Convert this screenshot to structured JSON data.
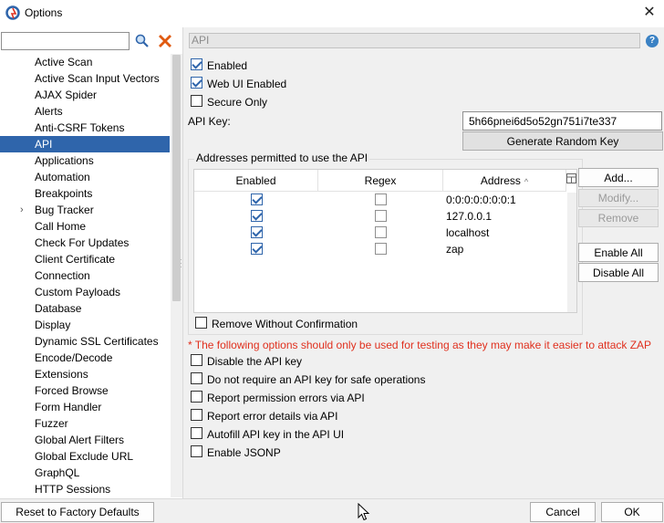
{
  "window": {
    "title": "Options",
    "close_glyph": "✕"
  },
  "sidebar": {
    "search_value": "",
    "items": [
      "Active Scan",
      "Active Scan Input Vectors",
      "AJAX Spider",
      "Alerts",
      "Anti-CSRF Tokens",
      "API",
      "Applications",
      "Automation",
      "Breakpoints",
      "Bug Tracker",
      "Call Home",
      "Check For Updates",
      "Client Certificate",
      "Connection",
      "Custom Payloads",
      "Database",
      "Display",
      "Dynamic SSL Certificates",
      "Encode/Decode",
      "Extensions",
      "Forced Browse",
      "Form Handler",
      "Fuzzer",
      "Global Alert Filters",
      "Global Exclude URL",
      "GraphQL",
      "HTTP Sessions"
    ],
    "selected": "API",
    "expandable": "Bug Tracker"
  },
  "panel": {
    "title": "API",
    "help_glyph": "?",
    "enabled_label": "Enabled",
    "enabled_checked": true,
    "web_ui_label": "Web UI Enabled",
    "web_ui_checked": true,
    "secure_only_label": "Secure Only",
    "secure_only_checked": false,
    "api_key_label": "API Key:",
    "api_key_value": "5h66pnei6d5o52gn751i7te337",
    "generate_label": "Generate Random Key",
    "addresses_title": "Addresses permitted to use the API",
    "table": {
      "headers": [
        "Enabled",
        "Regex",
        "Address"
      ],
      "sort_glyph": "^",
      "rows": [
        {
          "enabled": true,
          "regex": false,
          "address": "0:0:0:0:0:0:0:1"
        },
        {
          "enabled": true,
          "regex": false,
          "address": "127.0.0.1"
        },
        {
          "enabled": true,
          "regex": false,
          "address": "localhost"
        },
        {
          "enabled": true,
          "regex": false,
          "address": "zap"
        }
      ]
    },
    "buttons": {
      "add": "Add...",
      "modify": "Modify...",
      "remove": "Remove",
      "enable_all": "Enable All",
      "disable_all": "Disable All"
    },
    "remove_without_confirmation": "Remove Without Confirmation",
    "warning": "* The following options should only be used for testing as they may make it easier to attack ZAP",
    "testing_options": [
      "Disable the API key",
      "Do not require an API key for safe operations",
      "Report permission errors via API",
      "Report error details via API",
      "Autofill API key in the API UI",
      "Enable JSONP"
    ]
  },
  "footer": {
    "reset_label": "Reset to Factory Defaults",
    "cancel_label": "Cancel",
    "ok_label": "OK"
  },
  "colors": {
    "selection": "#2f65ab",
    "warning": "#e0301e",
    "accent": "#3b82c4"
  }
}
